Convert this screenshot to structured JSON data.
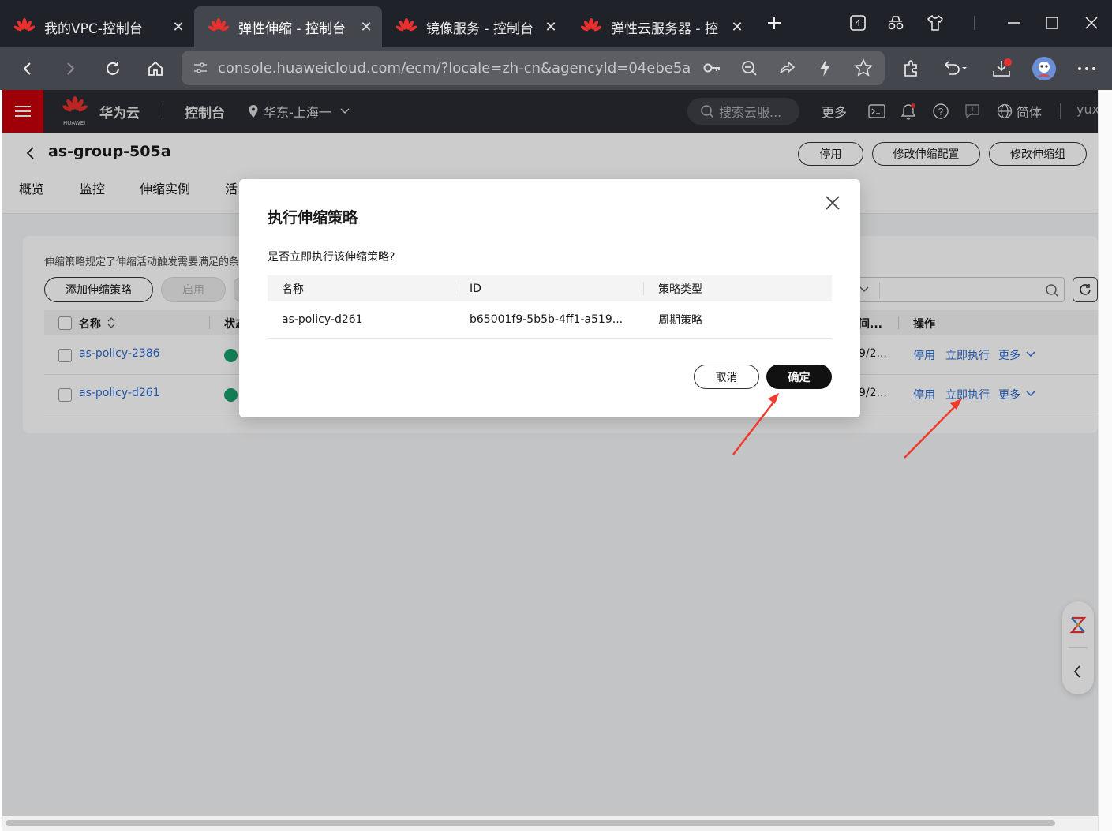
{
  "browser": {
    "tabs": [
      {
        "title": "我的VPC-控制台",
        "active": false
      },
      {
        "title": "弹性伸缩 - 控制台",
        "active": true
      },
      {
        "title": "镜像服务 - 控制台",
        "active": false
      },
      {
        "title": "弹性云服务器 - 控",
        "active": false
      }
    ],
    "tab_count_badge": "4",
    "address": "console.huaweicloud.com/ecm/?locale=zh-cn&agencyId=04ebe5a..."
  },
  "console": {
    "brand_small": "HUAWEI",
    "brand": "华为云",
    "console_label": "控制台",
    "region": "华东-上海一",
    "search_placeholder": "搜索云服...",
    "more": "更多",
    "lang": "简体",
    "user": "yuxi",
    "accent": "#c7000b"
  },
  "group": {
    "title": "as-group-505a",
    "actions": [
      "停用",
      "修改伸缩配置",
      "修改伸缩组"
    ],
    "tabs": [
      "概览",
      "监控",
      "伸缩实例",
      "活"
    ]
  },
  "policy_panel": {
    "description": "伸缩策略规定了伸缩活动触发需要满足的条件",
    "add_button": "添加伸缩策略",
    "enable_button": "启用",
    "columns": {
      "name": "名称",
      "status": "状态",
      "time": "间...",
      "ops": "操作"
    },
    "rows": [
      {
        "name": "as-policy-2386",
        "time": "9/2...",
        "ops": [
          "停用",
          "立即执行",
          "更多"
        ]
      },
      {
        "name": "as-policy-d261",
        "time": "9/2...",
        "ops": [
          "停用",
          "立即执行",
          "更多"
        ]
      }
    ]
  },
  "modal": {
    "title": "执行伸缩策略",
    "question": "是否立即执行该伸缩策略?",
    "columns": [
      "名称",
      "ID",
      "策略类型"
    ],
    "row": {
      "name": "as-policy-d261",
      "id": "b65001f9-5b5b-4ff1-a519...",
      "type": "周期策略"
    },
    "cancel": "取消",
    "confirm": "确定"
  }
}
